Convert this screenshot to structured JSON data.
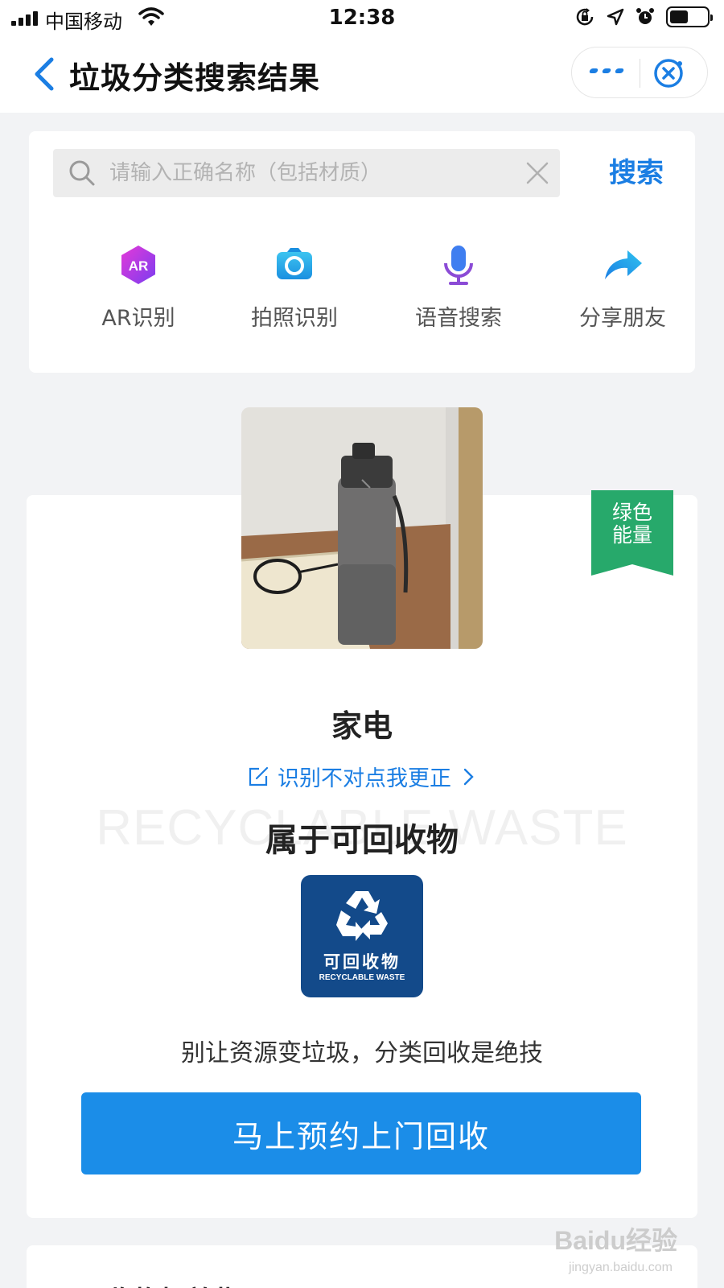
{
  "status_bar": {
    "carrier": "中国移动",
    "time": "12:38"
  },
  "nav": {
    "title": "垃圾分类搜索结果",
    "icons": [
      "back-icon",
      "more-icon",
      "close-mini-icon"
    ],
    "accent_color": "#1b7ee3"
  },
  "search": {
    "placeholder": "请输入正确名称（包括材质）",
    "value": "",
    "button_label": "搜索"
  },
  "tools": [
    {
      "label": "AR识别",
      "icon": "ar-icon"
    },
    {
      "label": "拍照识别",
      "icon": "camera-icon"
    },
    {
      "label": "语音搜索",
      "icon": "microphone-icon"
    },
    {
      "label": "分享朋友",
      "icon": "share-icon"
    }
  ],
  "result": {
    "ribbon": "绿色能量",
    "ribbon_color": "#27a96b",
    "item_name": "家电",
    "correct_link": "识别不对点我更正",
    "watermark": "RECYCLABLE WASTE",
    "category": "属于可回收物",
    "badge_cn": "可回收物",
    "badge_en": "RECYCLABLE WASTE",
    "badge_color": "#134a8a",
    "slogan": "别让资源变垃圾，分类回收是绝技",
    "book_button": "马上预约上门回收",
    "button_color": "#1b8de8"
  },
  "next_section": {
    "title": "可回收物投放指导"
  },
  "corner_watermark": {
    "brand": "Baidu经验",
    "url": "jingyan.baidu.com"
  }
}
